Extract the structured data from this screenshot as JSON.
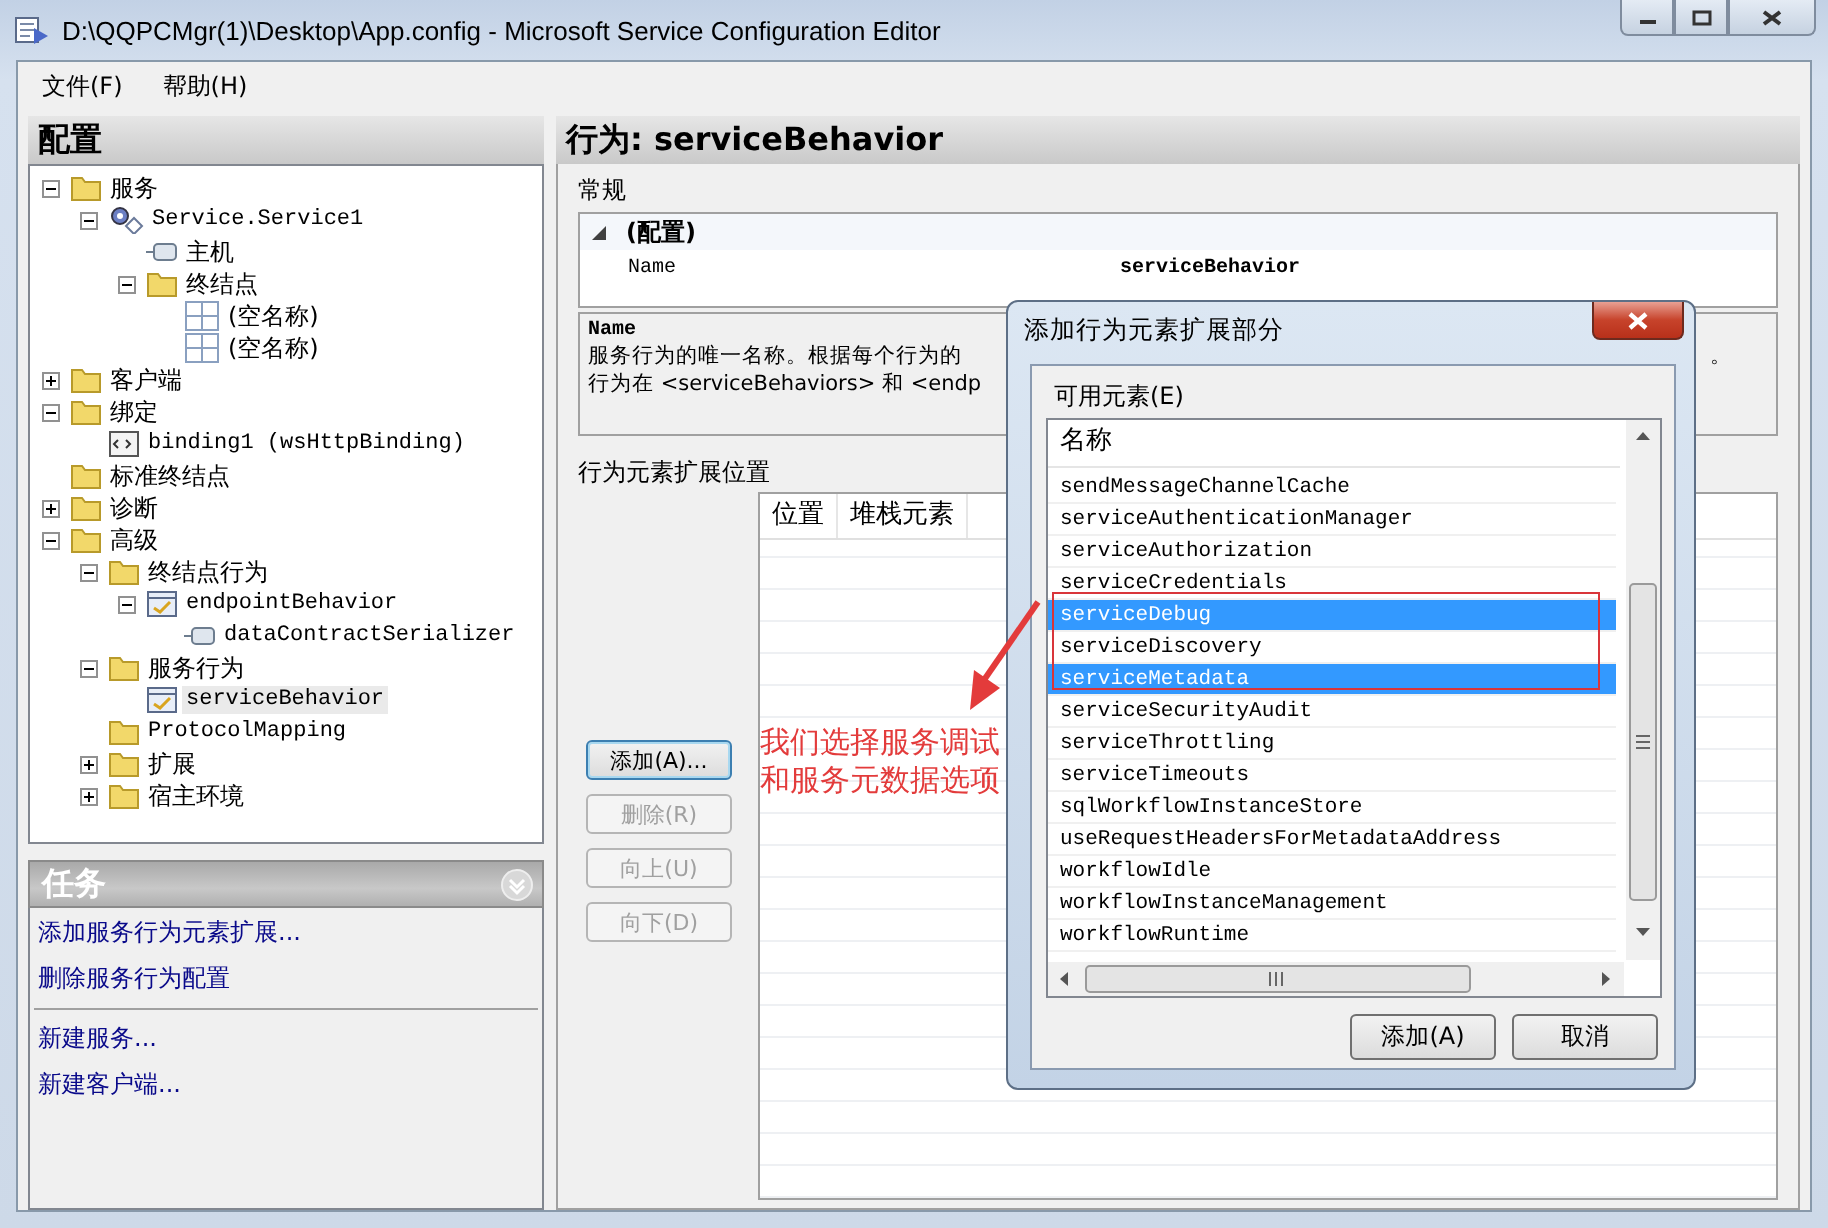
{
  "window": {
    "title": "D:\\QQPCMgr(1)\\Desktop\\App.config - Microsoft Service Configuration Editor"
  },
  "menu": [
    {
      "label": "文件(F)"
    },
    {
      "label": "帮助(H)"
    }
  ],
  "config_panel": {
    "title": "配置",
    "tree": [
      {
        "label": "服务",
        "kind": "folder",
        "expanded": true,
        "selected": false,
        "children": [
          {
            "label": "Service.Service1",
            "kind": "service",
            "expanded": true,
            "selected": false,
            "children": [
              {
                "label": "主机",
                "kind": "host",
                "selected": false
              },
              {
                "label": "终结点",
                "kind": "folder",
                "expanded": true,
                "selected": false,
                "children": [
                  {
                    "label": "(空名称)",
                    "kind": "endpoint",
                    "selected": false
                  },
                  {
                    "label": "(空名称)",
                    "kind": "endpoint",
                    "selected": false
                  }
                ]
              }
            ]
          }
        ]
      },
      {
        "label": "客户端",
        "kind": "folder",
        "expanded": false,
        "selected": false
      },
      {
        "label": "绑定",
        "kind": "folder",
        "expanded": true,
        "selected": false,
        "children": [
          {
            "label": "binding1 (wsHttpBinding)",
            "kind": "binding",
            "selected": false
          }
        ]
      },
      {
        "label": "标准终结点",
        "kind": "folder",
        "selected": false
      },
      {
        "label": "诊断",
        "kind": "folder",
        "expanded": false,
        "selected": false
      },
      {
        "label": "高级",
        "kind": "folder",
        "expanded": true,
        "selected": false,
        "children": [
          {
            "label": "终结点行为",
            "kind": "folder",
            "expanded": true,
            "selected": false,
            "children": [
              {
                "label": "endpointBehavior",
                "kind": "behavior",
                "expanded": true,
                "selected": false,
                "children": [
                  {
                    "label": "dataContractSerializer",
                    "kind": "host",
                    "selected": false
                  }
                ]
              }
            ]
          },
          {
            "label": "服务行为",
            "kind": "folder",
            "expanded": true,
            "selected": false,
            "children": [
              {
                "label": "serviceBehavior",
                "kind": "behavior",
                "selected": true
              }
            ]
          },
          {
            "label": "ProtocolMapping",
            "kind": "folder",
            "selected": false
          },
          {
            "label": "扩展",
            "kind": "folder",
            "expanded": false,
            "selected": false
          },
          {
            "label": "宿主环境",
            "kind": "folder",
            "expanded": false,
            "selected": false
          }
        ]
      }
    ]
  },
  "tasks_panel": {
    "title": "任务",
    "groups": [
      [
        "添加服务行为元素扩展...",
        "删除服务行为配置"
      ],
      [
        "新建服务...",
        "新建客户端..."
      ]
    ]
  },
  "detail": {
    "title": "行为: serviceBehavior",
    "general": {
      "title": "常规",
      "category": "(配置)",
      "properties": [
        {
          "name": "Name",
          "value": "serviceBehavior"
        }
      ],
      "description": {
        "title": "Name",
        "line_1": "服务行为的唯一名称。根据每个行为的",
        "line_1_end": "。",
        "line_2": "行为在 <serviceBehaviors> 和 <endp"
      }
    },
    "extensions": {
      "title": "行为元素扩展位置",
      "columns": [
        "位置",
        "堆栈元素"
      ],
      "buttons": [
        {
          "label": "添加(A)...",
          "disabled": false
        },
        {
          "label": "删除(R)",
          "disabled": true
        },
        {
          "label": "向上(U)",
          "disabled": true
        },
        {
          "label": "向下(D)",
          "disabled": true
        }
      ]
    }
  },
  "dialog": {
    "title": "添加行为元素扩展部分",
    "list_label": "可用元素(E)",
    "column": "名称",
    "items": [
      {
        "label": "sendMessageChannelCache",
        "selected": false
      },
      {
        "label": "serviceAuthenticationManager",
        "selected": false
      },
      {
        "label": "serviceAuthorization",
        "selected": false
      },
      {
        "label": "serviceCredentials",
        "selected": false
      },
      {
        "label": "serviceDebug",
        "selected": true
      },
      {
        "label": "serviceDiscovery",
        "selected": false
      },
      {
        "label": "serviceMetadata",
        "selected": true
      },
      {
        "label": "serviceSecurityAudit",
        "selected": false
      },
      {
        "label": "serviceThrottling",
        "selected": false
      },
      {
        "label": "serviceTimeouts",
        "selected": false
      },
      {
        "label": "sqlWorkflowInstanceStore",
        "selected": false
      },
      {
        "label": "useRequestHeadersForMetadataAddress",
        "selected": false
      },
      {
        "label": "workflowIdle",
        "selected": false
      },
      {
        "label": "workflowInstanceManagement",
        "selected": false
      },
      {
        "label": "workflowRuntime",
        "selected": false
      }
    ],
    "buttons": [
      "添加(A)",
      "取消"
    ]
  },
  "annotation": {
    "text": "我们选择服务调试和服务元数据选项"
  }
}
